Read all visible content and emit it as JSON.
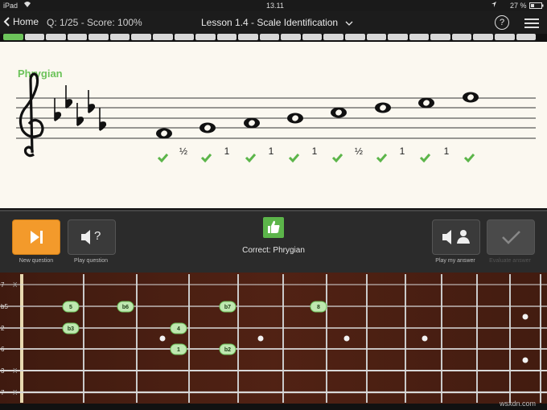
{
  "status": {
    "device": "iPad",
    "time": "13.11",
    "battery": "27 %"
  },
  "nav": {
    "back_label": "Home",
    "score": "Q: 1/25 - Score: 100%",
    "title": "Lesson 1.4 - Scale Identification",
    "help": "?"
  },
  "progress": {
    "completed": 1,
    "total": 25
  },
  "staff": {
    "scale_name": "Phrygian",
    "intervals": [
      "½",
      "1",
      "1",
      "1",
      "½",
      "1",
      "1"
    ]
  },
  "toolbar": {
    "new_question": "New question",
    "play_question": "Play question",
    "play_question_icon": "?",
    "correct": "Correct: Phrygian",
    "play_answer": "Play my answer",
    "evaluate": "Evaluate answer"
  },
  "fretboard": {
    "string_labels": [
      "7",
      "b5",
      "2",
      "6",
      "3",
      "7"
    ],
    "open_marks": [
      "X",
      "X",
      "X"
    ],
    "notes": [
      "5",
      "b6",
      "b7",
      "8",
      "b3",
      "4",
      "1",
      "b2"
    ]
  },
  "watermark": "wsxdn.com",
  "colors": {
    "accent_green": "#6cc35a",
    "orange": "#f39a2b"
  }
}
